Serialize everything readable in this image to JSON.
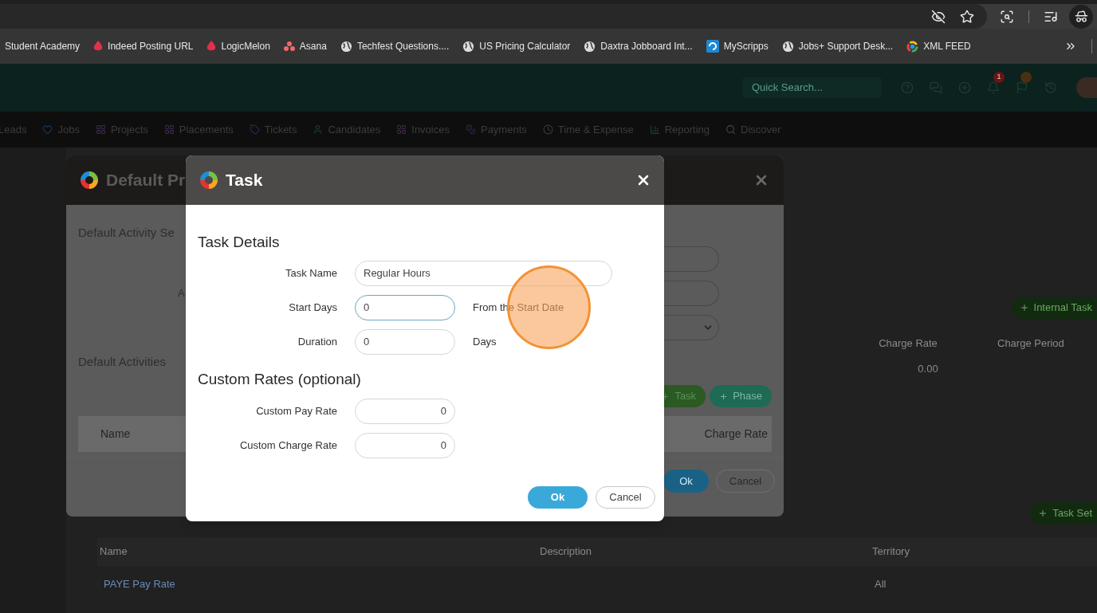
{
  "bookmarks": [
    {
      "label": "Student Academy",
      "kind": "none"
    },
    {
      "label": "Indeed Posting URL",
      "kind": "flame"
    },
    {
      "label": "LogicMelon",
      "kind": "flame"
    },
    {
      "label": "Asana",
      "kind": "dots"
    },
    {
      "label": "Techfest Questions....",
      "kind": "globe"
    },
    {
      "label": "US Pricing Calculator",
      "kind": "globe"
    },
    {
      "label": "Daxtra Jobboard Int...",
      "kind": "globe"
    },
    {
      "label": "MyScripps",
      "kind": "square"
    },
    {
      "label": "Jobs+ Support Desk...",
      "kind": "globe"
    },
    {
      "label": "XML FEED",
      "kind": "ring"
    }
  ],
  "app_header": {
    "search": {
      "placeholder": "Quick Search..."
    },
    "notification_count": "1"
  },
  "nav": [
    {
      "label": "Leads",
      "kind": "none"
    },
    {
      "label": "Jobs",
      "kind": "heart"
    },
    {
      "label": "Projects",
      "kind": "grid"
    },
    {
      "label": "Placements",
      "kind": "grid"
    },
    {
      "label": "Tickets",
      "kind": "tag"
    },
    {
      "label": "Candidates",
      "kind": "user"
    },
    {
      "label": "Invoices",
      "kind": "grid"
    },
    {
      "label": "Payments",
      "kind": "coin"
    },
    {
      "label": "Time & Expense",
      "kind": "clock"
    },
    {
      "label": "Reporting",
      "kind": "chart"
    },
    {
      "label": "Discover",
      "kind": "search"
    }
  ],
  "page": {
    "internal_task_button": "Internal Task",
    "upper_columns": [
      "Charge Rate",
      "Charge Period"
    ],
    "upper_value": "0.00",
    "task_set_button": "Task Set",
    "columns": [
      "Name",
      "Description",
      "Territory"
    ],
    "rows": [
      {
        "name": "PAYE Pay Rate",
        "territory": "All"
      }
    ]
  },
  "default_modal": {
    "title": "Default Pr",
    "section": "Default Activity Se",
    "field_label": "A",
    "activities_title": "Default Activities",
    "buttons": [
      {
        "label": "Task",
        "kind": "task"
      },
      {
        "label": "Phase",
        "kind": "phase"
      }
    ],
    "columns": [
      "Name",
      "Charge Rate"
    ],
    "ok": "Ok",
    "cancel": "Cancel"
  },
  "task_modal": {
    "title": "Task",
    "details_title": "Task Details",
    "fields": [
      {
        "label": "Task Name",
        "value": "Regular Hours",
        "kind": "wide",
        "focused": false
      },
      {
        "label": "Start Days",
        "value": "0",
        "kind": "narrow",
        "focused": true,
        "suffix": "From the Start Date"
      },
      {
        "label": "Duration",
        "value": "0",
        "kind": "narrow",
        "focused": false,
        "suffix": "Days"
      }
    ],
    "rates_title": "Custom Rates (optional)",
    "rates": [
      {
        "label": "Custom Pay Rate",
        "value": "0"
      },
      {
        "label": "Custom Charge Rate",
        "value": "0"
      }
    ],
    "ok": "Ok",
    "cancel": "Cancel"
  }
}
